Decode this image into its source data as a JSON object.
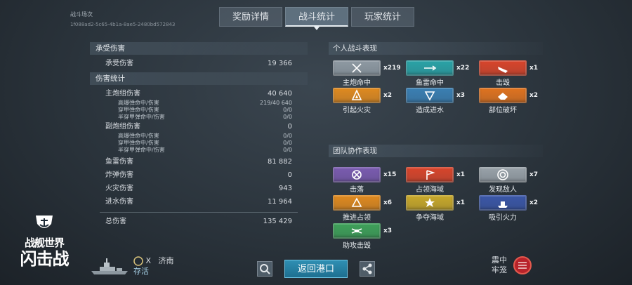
{
  "battle": {
    "label": "战斗场次",
    "id": "1f088ad2-5c65-4b1a-8ae5-2480bd572843"
  },
  "tabs": [
    {
      "label": "奖励详情"
    },
    {
      "label": "战斗统计"
    },
    {
      "label": "玩家统计"
    }
  ],
  "damage_received": {
    "header": "承受伤害",
    "label": "承受伤害",
    "value": "19 366"
  },
  "damage_stats": {
    "header": "伤害统计",
    "main_battery": {
      "label": "主炮组伤害",
      "value": "40 640"
    },
    "main_he": {
      "label": "高爆弹命中/伤害",
      "value": "219/40 640"
    },
    "main_ap": {
      "label": "穿甲弹命中/伤害",
      "value": "0/0"
    },
    "main_sap": {
      "label": "半穿甲弹命中/伤害",
      "value": "0/0"
    },
    "secondary": {
      "label": "副炮组伤害",
      "value": "0"
    },
    "sec_he": {
      "label": "高爆弹命中/伤害",
      "value": "0/0"
    },
    "sec_ap": {
      "label": "穿甲弹命中/伤害",
      "value": "0/0"
    },
    "sec_sap": {
      "label": "半穿甲弹命中/伤害",
      "value": "0/0"
    },
    "torpedo": {
      "label": "鱼雷伤害",
      "value": "81 882"
    },
    "bomb": {
      "label": "炸弹伤害",
      "value": "0"
    },
    "fire": {
      "label": "火灾伤害",
      "value": "943"
    },
    "flooding": {
      "label": "进水伤害",
      "value": "11 964"
    },
    "total": {
      "label": "总伤害",
      "value": "135 429"
    }
  },
  "personal": {
    "header": "个人战斗表现",
    "ribbons": [
      {
        "label": "主炮命中",
        "count": "x219",
        "color": "#8f9aa3",
        "icon": "crossed-shells-icon"
      },
      {
        "label": "鱼雷命中",
        "count": "x22",
        "color": "#2aa3a7",
        "icon": "torpedo-icon"
      },
      {
        "label": "击毁",
        "count": "x1",
        "color": "#d9452b",
        "icon": "sinking-ship-icon"
      },
      {
        "label": "引起火灾",
        "count": "x2",
        "color": "#e08a1f",
        "icon": "fire-icon"
      },
      {
        "label": "造成进水",
        "count": "x3",
        "color": "#3a7fb3",
        "icon": "flood-icon"
      },
      {
        "label": "部位破坏",
        "count": "x2",
        "color": "#e0731f",
        "icon": "broken-module-icon"
      }
    ]
  },
  "team": {
    "header": "团队协作表现",
    "ribbons": [
      {
        "label": "击落",
        "count": "x15",
        "color": "#7a5bb0",
        "icon": "plane-shot-icon"
      },
      {
        "label": "占领海域",
        "count": "x1",
        "color": "#d9452b",
        "icon": "flag-icon"
      },
      {
        "label": "发现敌人",
        "count": "x7",
        "color": "#9aa3aa",
        "icon": "target-icon"
      },
      {
        "label": "推进占领",
        "count": "x6",
        "color": "#e08a1f",
        "icon": "capture-icon"
      },
      {
        "label": "争夺海域",
        "count": "x1",
        "color": "#c9a92a",
        "icon": "defend-icon"
      },
      {
        "label": "吸引火力",
        "count": "x2",
        "color": "#3b57a8",
        "icon": "tank-damage-icon"
      },
      {
        "label": "助攻击毁",
        "count": "x3",
        "color": "#3fa25a",
        "icon": "assist-icon"
      }
    ]
  },
  "logo": {
    "line1": "战舰世界",
    "line2": "闪击战"
  },
  "ship": {
    "tier": "X",
    "name": "济南",
    "status": "存活"
  },
  "footer": {
    "return_label": "返回港口",
    "cage_line1": "震中",
    "cage_line2": "牢笼"
  }
}
